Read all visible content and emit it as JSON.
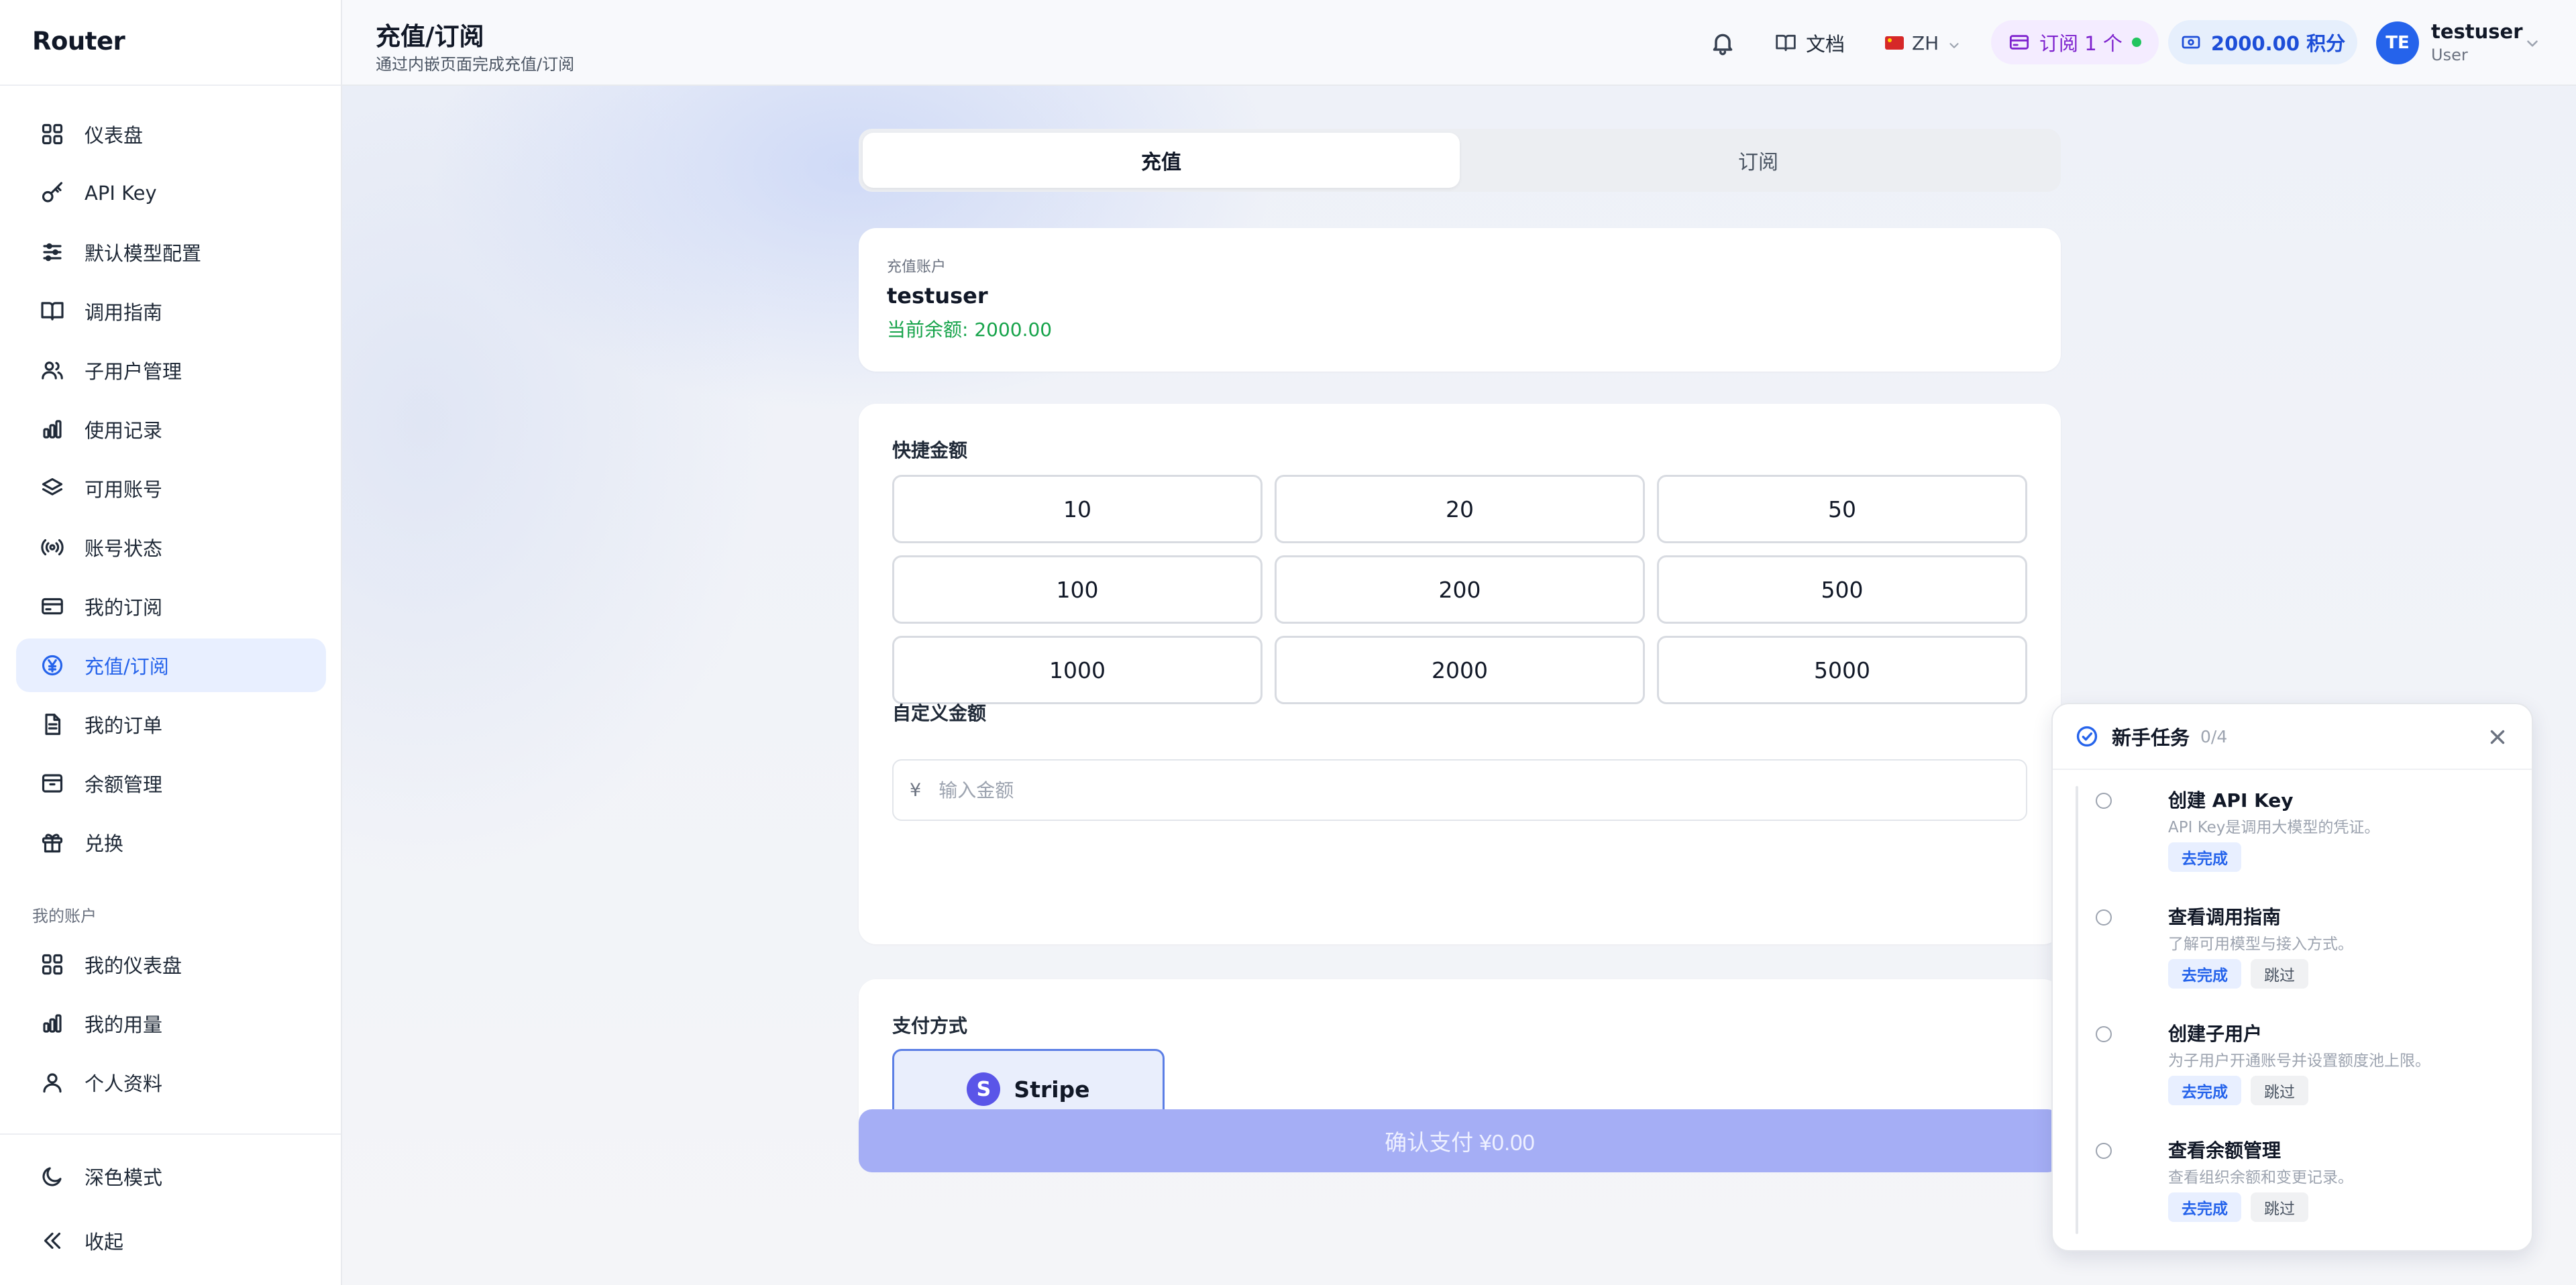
{
  "app": {
    "title": "Router"
  },
  "sidebar": {
    "items": [
      {
        "label": "仪表盘",
        "icon": "grid-icon"
      },
      {
        "label": "API Key",
        "icon": "key-icon"
      },
      {
        "label": "默认模型配置",
        "icon": "sliders-icon"
      },
      {
        "label": "调用指南",
        "icon": "book-icon"
      },
      {
        "label": "子用户管理",
        "icon": "users-icon"
      },
      {
        "label": "使用记录",
        "icon": "bar-chart-icon"
      },
      {
        "label": "可用账号",
        "icon": "layers-icon"
      },
      {
        "label": "账号状态",
        "icon": "signal-icon"
      },
      {
        "label": "我的订阅",
        "icon": "card-icon"
      },
      {
        "label": "充值/订阅",
        "icon": "yen-circle-icon",
        "active": true
      },
      {
        "label": "我的订单",
        "icon": "document-icon"
      },
      {
        "label": "余额管理",
        "icon": "wallet-icon"
      },
      {
        "label": "兑换",
        "icon": "gift-icon"
      }
    ],
    "section_label": "我的账户",
    "account_items": [
      {
        "label": "我的仪表盘",
        "icon": "grid-icon"
      },
      {
        "label": "我的用量",
        "icon": "bar-chart-icon"
      },
      {
        "label": "个人资料",
        "icon": "user-icon"
      }
    ],
    "bottom": {
      "dark_mode": "深色模式",
      "collapse": "收起"
    }
  },
  "header": {
    "title": "充值/订阅",
    "subtitle": "通过内嵌页面完成充值/订阅",
    "docs": "文档",
    "lang": "ZH",
    "subscription": "订阅 1 个",
    "points": "2000.00 积分",
    "user": {
      "initials": "TE",
      "name": "testuser",
      "role": "User"
    }
  },
  "main": {
    "tabs": [
      {
        "label": "充值",
        "active": true
      },
      {
        "label": "订阅",
        "active": false
      }
    ],
    "account": {
      "label": "充值账户",
      "name": "testuser",
      "balance": "当前余额: 2000.00"
    },
    "quick_amount": {
      "title": "快捷金额",
      "amounts": [
        "10",
        "20",
        "50",
        "100",
        "200",
        "500",
        "1000",
        "2000",
        "5000"
      ]
    },
    "custom_amount": {
      "title": "自定义金额",
      "currency": "¥",
      "placeholder": "输入金额",
      "value": ""
    },
    "payment": {
      "title": "支付方式",
      "method": "Stripe",
      "logo_letter": "S"
    },
    "confirm": "确认支付 ¥0.00"
  },
  "onboarding": {
    "title": "新手任务",
    "progress": "0/4",
    "tasks": [
      {
        "name": "创建 API Key",
        "desc": "API Key是调用大模型的凭证。",
        "go": "去完成",
        "skip": null
      },
      {
        "name": "查看调用指南",
        "desc": "了解可用模型与接入方式。",
        "go": "去完成",
        "skip": "跳过"
      },
      {
        "name": "创建子用户",
        "desc": "为子用户开通账号并设置额度池上限。",
        "go": "去完成",
        "skip": "跳过"
      },
      {
        "name": "查看余额管理",
        "desc": "查看组织余额和变更记录。",
        "go": "去完成",
        "skip": "跳过"
      }
    ]
  },
  "colors": {
    "accent": "#2563eb",
    "balance_green": "#16a34a",
    "subscription_purple": "#7e22ce",
    "confirm_disabled": "#a5aef5"
  }
}
